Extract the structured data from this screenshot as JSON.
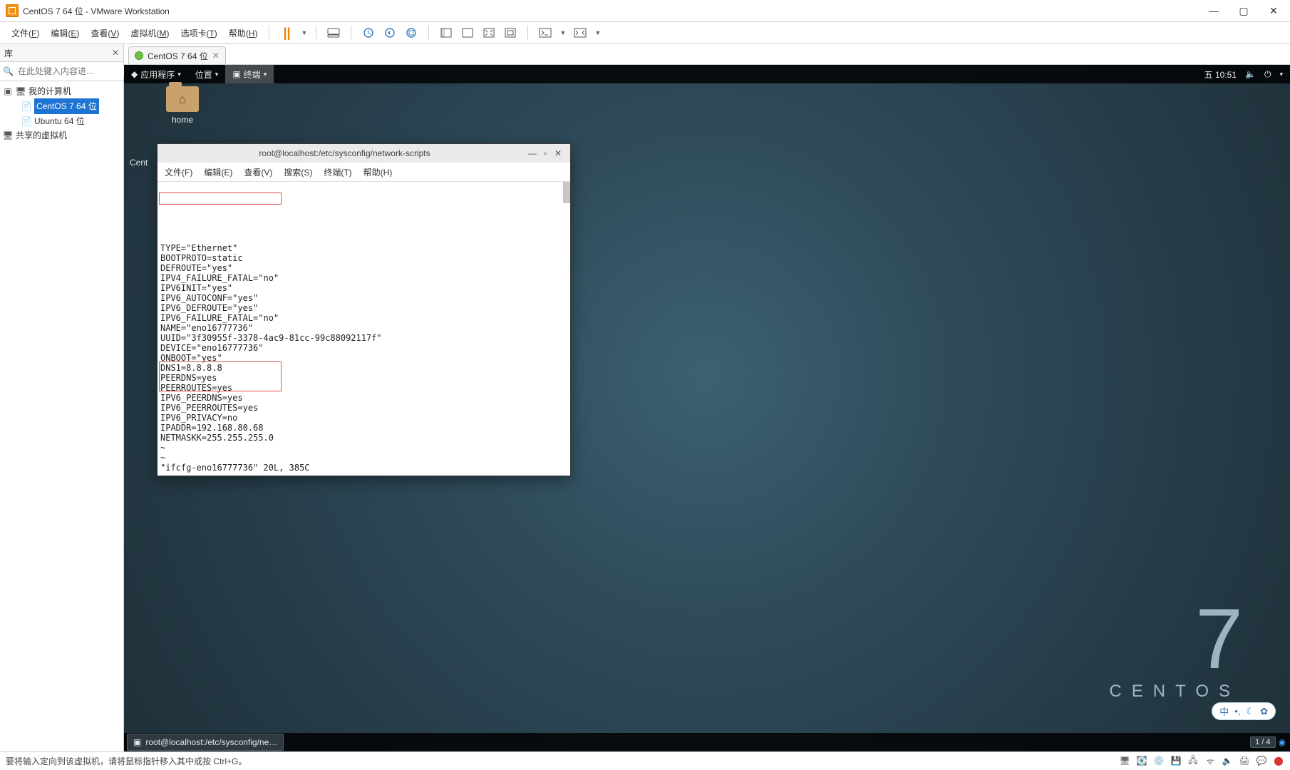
{
  "outer_window": {
    "title": "CentOS 7 64 位 - VMware Workstation",
    "controls": {
      "min": "—",
      "max": "▢",
      "close": "✕"
    }
  },
  "menubar": {
    "file": "文件",
    "file_acc": "F",
    "edit": "编辑",
    "edit_acc": "E",
    "view": "查看",
    "view_acc": "V",
    "vm": "虚拟机",
    "vm_acc": "M",
    "tabs": "选项卡",
    "tabs_acc": "T",
    "help": "帮助",
    "help_acc": "H"
  },
  "sidebar": {
    "title": "库",
    "search_placeholder": "在此处键入内容进...",
    "tree": {
      "root": "我的计算机",
      "vm1": "CentOS 7 64 位",
      "vm2": "Ubuntu 64 位",
      "shared": "共享的虚拟机"
    }
  },
  "vm_tab": {
    "label": "CentOS 7 64 位",
    "close": "✕"
  },
  "gnome": {
    "apps": "应用程序",
    "places": "位置",
    "terminal": "终端",
    "clock": "五 10:51",
    "desktop_icon": "home",
    "desktop_label": "Cent",
    "centos_7": "7",
    "centos_brand": "CENTOS"
  },
  "terminal": {
    "title": "root@localhost:/etc/sysconfig/network-scripts",
    "menu": {
      "file": "文件(F)",
      "edit": "编辑(E)",
      "view": "查看(V)",
      "search": "搜索(S)",
      "terminal": "终端(T)",
      "help": "帮助(H)"
    },
    "lines": [
      "TYPE=\"Ethernet\"",
      "BOOTPROTO=static",
      "DEFROUTE=\"yes\"",
      "IPV4_FAILURE_FATAL=\"no\"",
      "IPV6INIT=\"yes\"",
      "IPV6_AUTOCONF=\"yes\"",
      "IPV6_DEFROUTE=\"yes\"",
      "IPV6_FAILURE_FATAL=\"no\"",
      "NAME=\"eno16777736\"",
      "UUID=\"3f30955f-3378-4ac9-81cc-99c88092117f\"",
      "DEVICE=\"eno16777736\"",
      "ONBOOT=\"yes\"",
      "DNS1=8.8.8.8",
      "PEERDNS=yes",
      "PEERROUTES=yes",
      "IPV6_PEERDNS=yes",
      "IPV6_PEERROUTES=yes",
      "IPV6_PRIVACY=no",
      "IPADDR=192.168.80.68",
      "NETMASKK=255.255.255.0",
      "~",
      "~",
      "\"ifcfg-eno16777736\" 20L, 385C"
    ],
    "taskbar_item": "root@localhost:/etc/sysconfig/ne…",
    "workspace": "1 / 4"
  },
  "ime": {
    "label": "中",
    "dots": "•,",
    "moon": "☾",
    "cog": "✿"
  },
  "statusbar": {
    "hint": "要将输入定向到该虚拟机，请将鼠标指针移入其中或按 Ctrl+G。"
  }
}
